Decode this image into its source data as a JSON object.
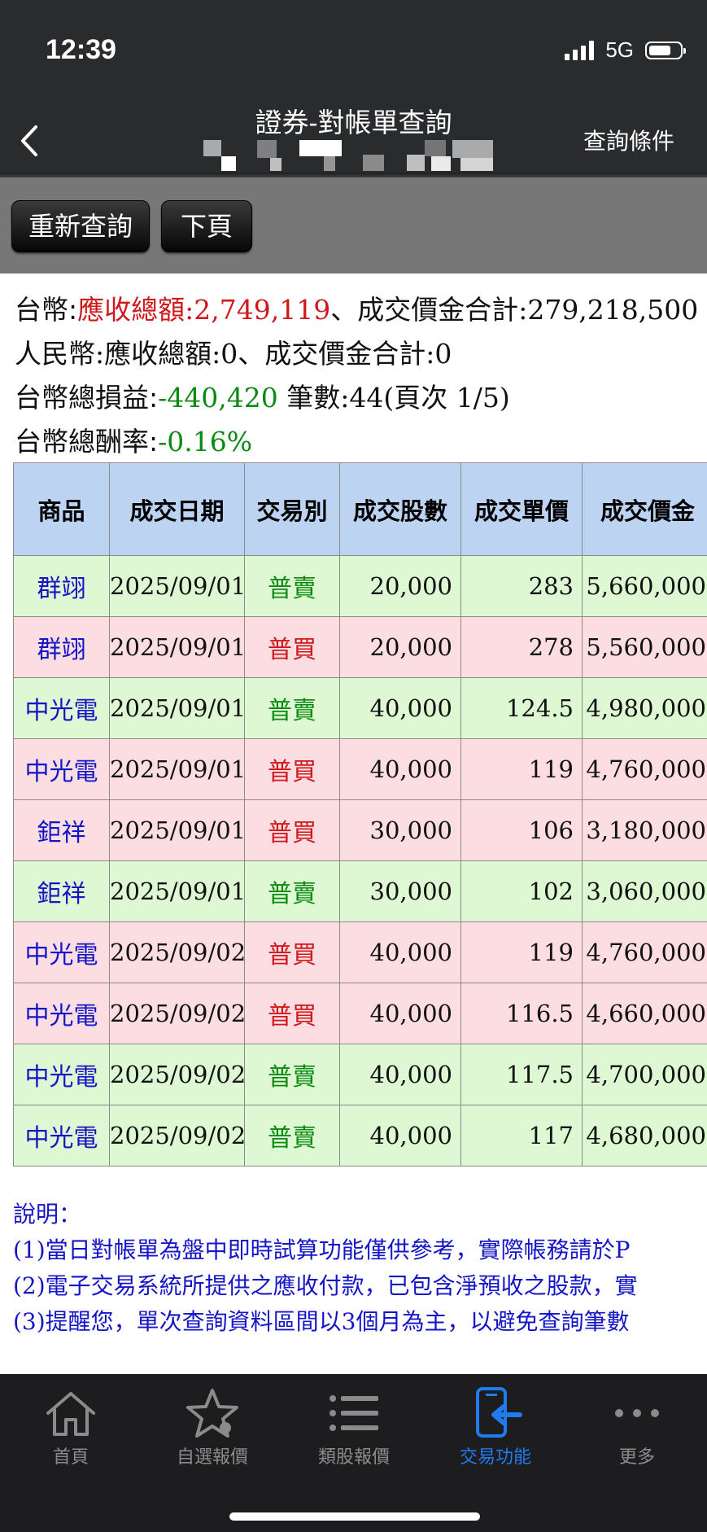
{
  "status_bar": {
    "time": "12:39",
    "network": "5G"
  },
  "header": {
    "title": "證券-對帳單查詢",
    "right_action": "查詢條件"
  },
  "toolbar": {
    "requery_label": "重新查詢",
    "next_page_label": "下頁"
  },
  "summary": {
    "twd_label": "台幣:",
    "twd_receivable_label": "應收總額:2,749,119",
    "twd_sep": "、成交價金合計:279,218,500",
    "rmb_line": "人民幣:應收總額:0、成交價金合計:0",
    "pl_label": "台幣總損益:",
    "pl_value": "-440,420",
    "count_text": " 筆數:44(頁次 1/5)",
    "return_label": "台幣總酬率:",
    "return_value": "-0.16%"
  },
  "table": {
    "headers": [
      "商品",
      "成交日期",
      "交易別",
      "成交股數",
      "成交單價",
      "成交價金"
    ],
    "rows": [
      {
        "product": "群翊",
        "date": "2025/09/01",
        "type": "普賣",
        "shares": "20,000",
        "price": "283",
        "amount": "5,660,000"
      },
      {
        "product": "群翊",
        "date": "2025/09/01",
        "type": "普買",
        "shares": "20,000",
        "price": "278",
        "amount": "5,560,000"
      },
      {
        "product": "中光電",
        "date": "2025/09/01",
        "type": "普賣",
        "shares": "40,000",
        "price": "124.5",
        "amount": "4,980,000"
      },
      {
        "product": "中光電",
        "date": "2025/09/01",
        "type": "普買",
        "shares": "40,000",
        "price": "119",
        "amount": "4,760,000"
      },
      {
        "product": "鉅祥",
        "date": "2025/09/01",
        "type": "普買",
        "shares": "30,000",
        "price": "106",
        "amount": "3,180,000"
      },
      {
        "product": "鉅祥",
        "date": "2025/09/01",
        "type": "普賣",
        "shares": "30,000",
        "price": "102",
        "amount": "3,060,000"
      },
      {
        "product": "中光電",
        "date": "2025/09/02",
        "type": "普買",
        "shares": "40,000",
        "price": "119",
        "amount": "4,760,000"
      },
      {
        "product": "中光電",
        "date": "2025/09/02",
        "type": "普買",
        "shares": "40,000",
        "price": "116.5",
        "amount": "4,660,000"
      },
      {
        "product": "中光電",
        "date": "2025/09/02",
        "type": "普賣",
        "shares": "40,000",
        "price": "117.5",
        "amount": "4,700,000"
      },
      {
        "product": "中光電",
        "date": "2025/09/02",
        "type": "普賣",
        "shares": "40,000",
        "price": "117",
        "amount": "4,680,000"
      }
    ]
  },
  "notes": {
    "title": "說明：",
    "lines": [
      "(1)當日對帳單為盤中即時試算功能僅供參考，實際帳務請於P",
      "(2)電子交易系統所提供之應收付款，已包含淨預收之股款，實",
      "(3)提醒您，單次查詢資料區間以3個月為主，以避免查詢筆數"
    ]
  },
  "tabbar": {
    "items": [
      {
        "label": "首頁",
        "icon": "home-icon"
      },
      {
        "label": "自選報價",
        "icon": "star-icon"
      },
      {
        "label": "類股報價",
        "icon": "list-icon"
      },
      {
        "label": "交易功能",
        "icon": "trade-icon"
      },
      {
        "label": "更多",
        "icon": "more-icon"
      }
    ],
    "active_index": 3
  },
  "colors": {
    "buy": "#d0171b",
    "sell": "#0b8a12",
    "header_bg": "#bcd3f2",
    "active_tab": "#1f7cf0"
  }
}
